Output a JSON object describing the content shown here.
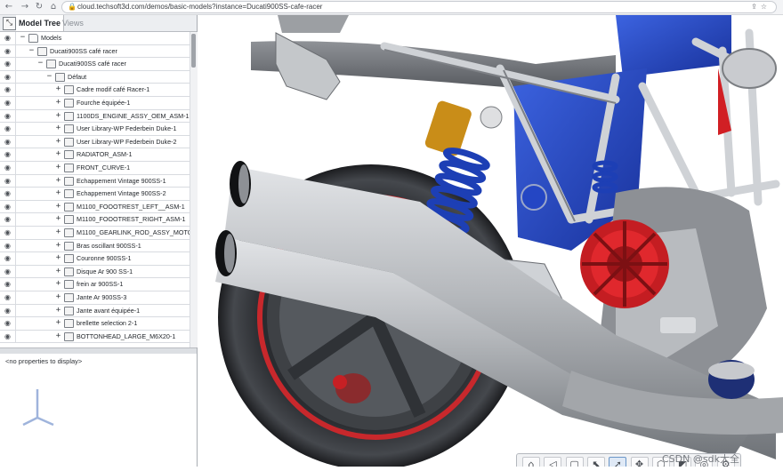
{
  "browser": {
    "url": "cloud.techsoft3d.com/demos/basic-models?instance=Ducati900SS-cafe-racer",
    "back_icon": "back-arrow-icon",
    "forward_icon": "forward-arrow-icon",
    "reload_icon": "reload-icon",
    "home_icon": "home-icon"
  },
  "left_panel": {
    "tabs": [
      {
        "label": "Model Tree",
        "active": true
      },
      {
        "label": "Views",
        "active": false
      }
    ],
    "tree": [
      {
        "label": "Models",
        "depth": 0,
        "toggle": "−",
        "icon": "folder"
      },
      {
        "label": "Ducati900SS café racer",
        "depth": 1,
        "toggle": "−",
        "icon": "assembly"
      },
      {
        "label": "Ducati900SS café racer",
        "depth": 2,
        "toggle": "−",
        "icon": "assembly"
      },
      {
        "label": "Défaut",
        "depth": 3,
        "toggle": "−",
        "icon": "assembly"
      },
      {
        "label": "Cadre modif café Racer-1",
        "depth": 4,
        "toggle": "+",
        "icon": "assembly"
      },
      {
        "label": "Fourche équipée-1",
        "depth": 4,
        "toggle": "+",
        "icon": "assembly"
      },
      {
        "label": "1100DS_ENGINE_ASSY_OEM_ASM-1",
        "depth": 4,
        "toggle": "+",
        "icon": "assembly"
      },
      {
        "label": "User Library-WP Federbein Duke-1",
        "depth": 4,
        "toggle": "+",
        "icon": "assembly"
      },
      {
        "label": "User Library-WP Federbein Duke-2",
        "depth": 4,
        "toggle": "+",
        "icon": "assembly"
      },
      {
        "label": "RADIATOR_ASM-1",
        "depth": 4,
        "toggle": "+",
        "icon": "assembly"
      },
      {
        "label": "FRONT_CURVE-1",
        "depth": 4,
        "toggle": "+",
        "icon": "assembly"
      },
      {
        "label": "Echappement Vintage 900SS-1",
        "depth": 4,
        "toggle": "+",
        "icon": "assembly"
      },
      {
        "label": "Echappement Vintage 900SS-2",
        "depth": 4,
        "toggle": "+",
        "icon": "assembly"
      },
      {
        "label": "M1100_FOOOTREST_LEFT__ASM-1",
        "depth": 4,
        "toggle": "+",
        "icon": "assembly"
      },
      {
        "label": "M1100_FOOOTREST_RIGHT_ASM-1",
        "depth": 4,
        "toggle": "+",
        "icon": "assembly"
      },
      {
        "label": "M1100_GEARLINK_ROD_ASSY_MOTOCO...",
        "depth": 4,
        "toggle": "+",
        "icon": "assembly"
      },
      {
        "label": "Bras oscillant 900SS-1",
        "depth": 4,
        "toggle": "+",
        "icon": "assembly"
      },
      {
        "label": "Couronne 900SS-1",
        "depth": 4,
        "toggle": "+",
        "icon": "assembly"
      },
      {
        "label": "Disque Ar 900 SS-1",
        "depth": 4,
        "toggle": "+",
        "icon": "assembly"
      },
      {
        "label": "frein ar 900SS-1",
        "depth": 4,
        "toggle": "+",
        "icon": "assembly"
      },
      {
        "label": "Jante Ar 900SS-3",
        "depth": 4,
        "toggle": "+",
        "icon": "assembly"
      },
      {
        "label": "Jante avant équipée-1",
        "depth": 4,
        "toggle": "+",
        "icon": "assembly"
      },
      {
        "label": "brellette selection 2-1",
        "depth": 4,
        "toggle": "+",
        "icon": "assembly"
      },
      {
        "label": "BOTTONHEAD_LARGE_M6X20-1",
        "depth": 4,
        "toggle": "+",
        "icon": "assembly"
      }
    ],
    "properties_text": "<no properties to display>"
  },
  "viewer": {
    "toolbar": [
      {
        "name": "home-view-button",
        "icon": "home-icon",
        "glyph": "⌂"
      },
      {
        "name": "camera-button",
        "icon": "camera-view-icon",
        "glyph": "◁"
      },
      {
        "name": "view-cube-button",
        "icon": "cube-icon",
        "glyph": "▢"
      },
      {
        "name": "select-tool-button",
        "icon": "select-pointer-icon",
        "glyph": "⬉"
      },
      {
        "name": "pointer-button",
        "icon": "pointer-icon",
        "glyph": "➚"
      },
      {
        "name": "explode-button",
        "icon": "explode-icon",
        "glyph": "✥"
      },
      {
        "name": "model-view-button",
        "icon": "part-icon",
        "glyph": "⬡"
      },
      {
        "name": "cutting-plane-button",
        "icon": "cutting-plane-icon",
        "glyph": "◩"
      },
      {
        "name": "snapshot-button",
        "icon": "snapshot-icon",
        "glyph": "◎"
      },
      {
        "name": "settings-button",
        "icon": "gear-icon",
        "glyph": "⚙"
      }
    ],
    "active_toolbar_index": 4
  },
  "watermark": "CSDN @sdk大全",
  "colors": {
    "frame_blue": "#2448c8",
    "red_accent": "#d11f24",
    "spring_blue": "#1d3fb5",
    "shock_gold": "#c98d18",
    "metal_grey": "#b9bcc0"
  }
}
